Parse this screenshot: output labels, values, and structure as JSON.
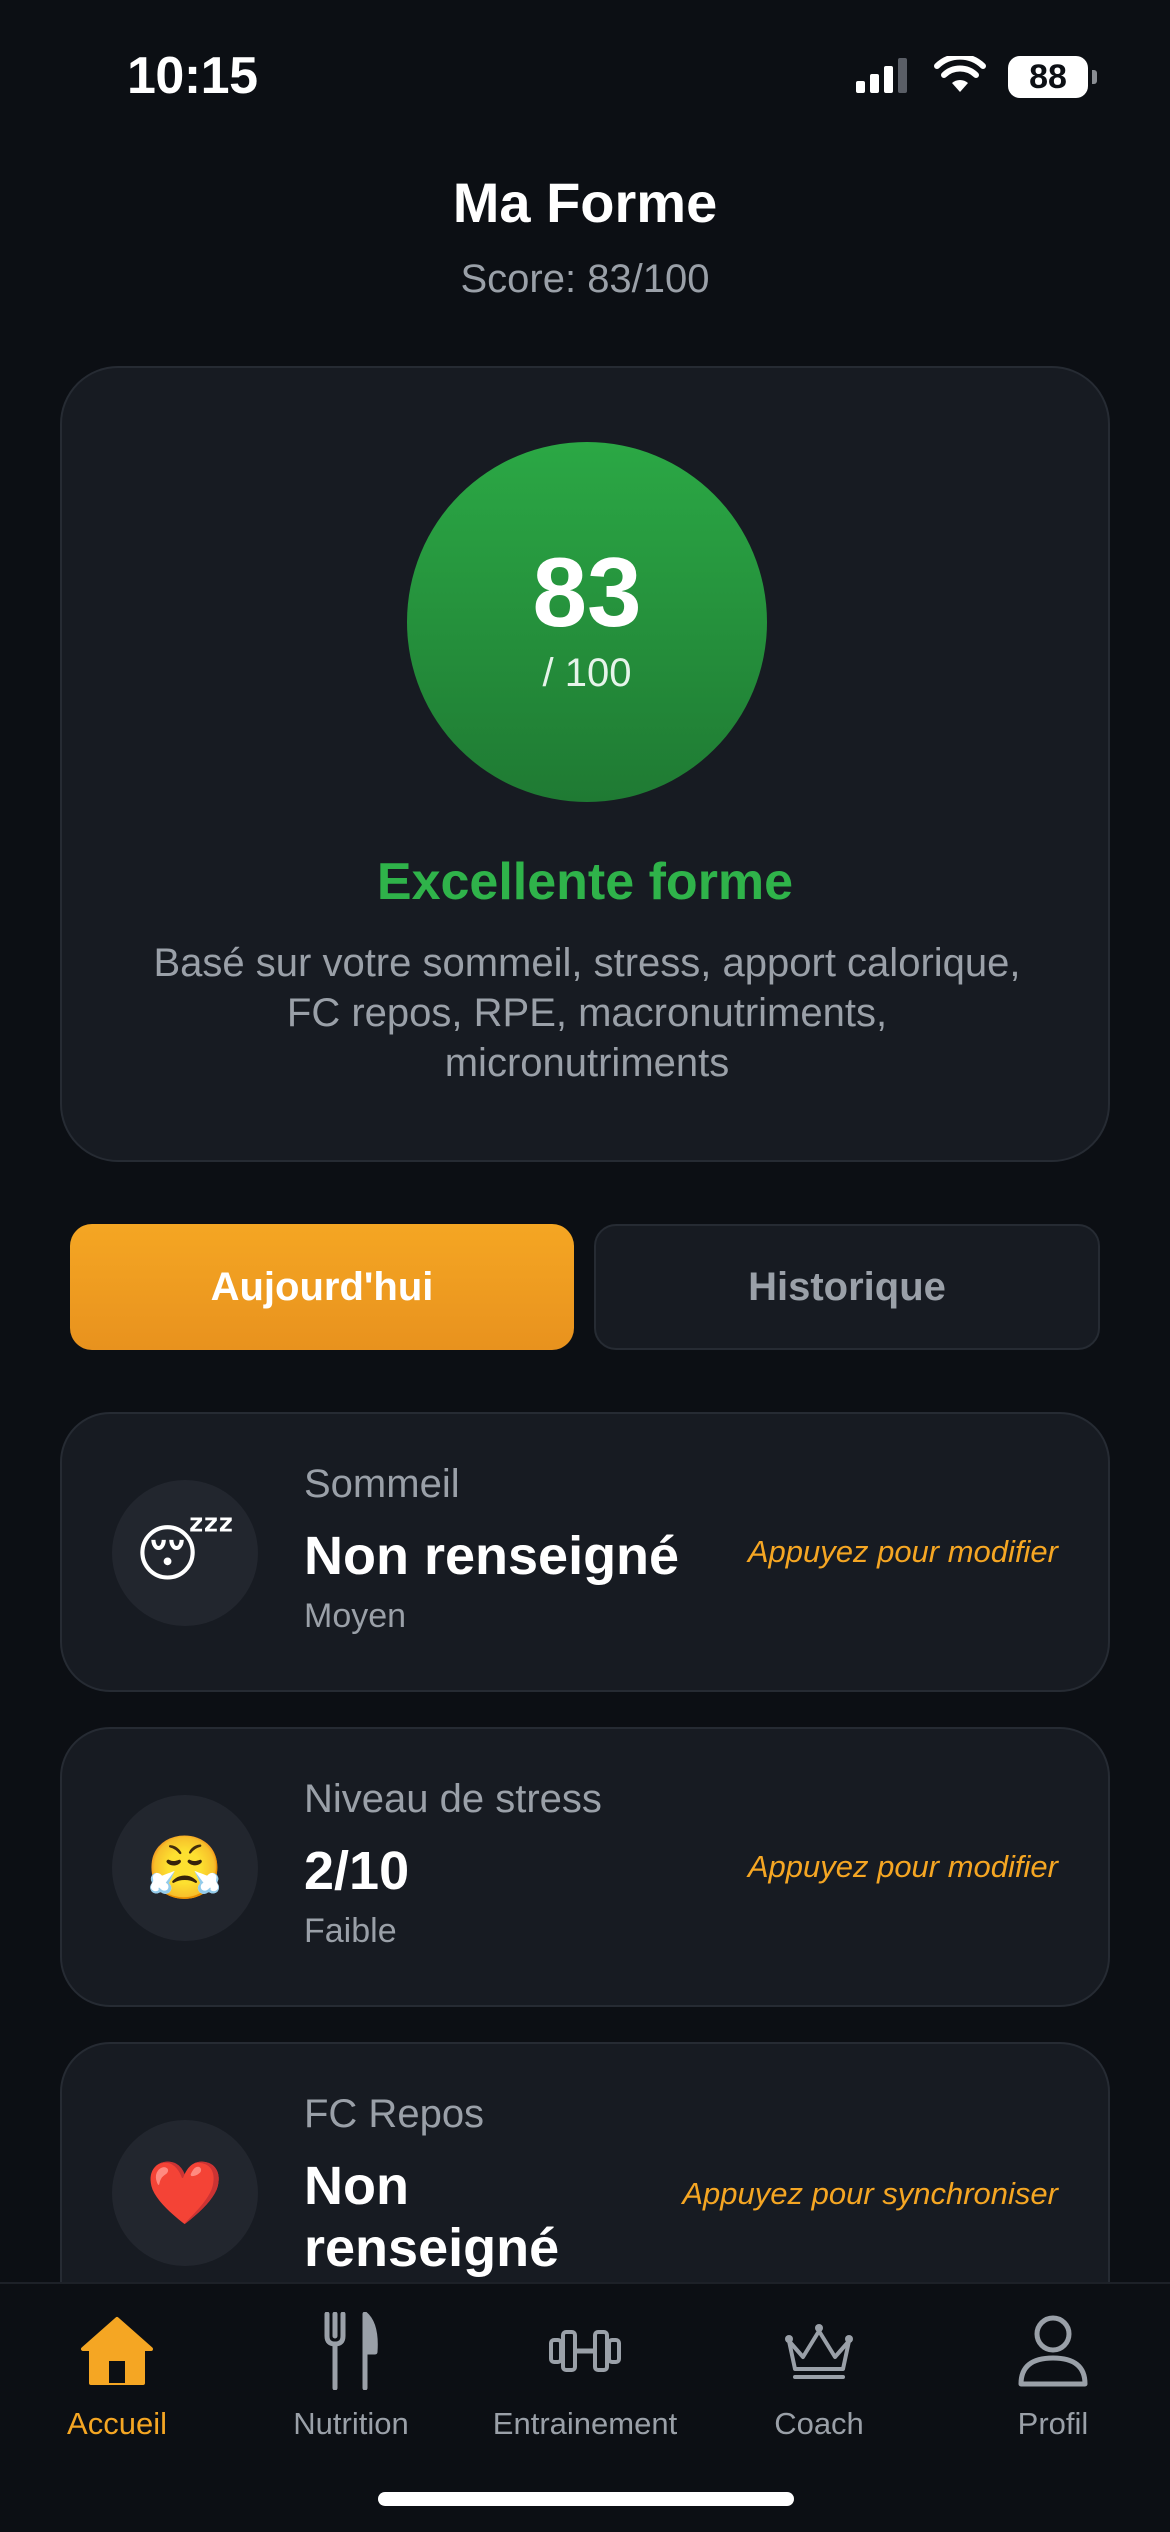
{
  "status_bar": {
    "time": "10:15",
    "battery": "88"
  },
  "header": {
    "title": "Ma Forme",
    "subtitle": "Score: 83/100"
  },
  "score_card": {
    "score": "83",
    "max": "/ 100",
    "label": "Excellente forme",
    "label_color": "#2fb34a",
    "description": "Basé sur votre sommeil, stress, apport calorique, FC repos, RPE, macronutriments, micronutriments"
  },
  "tabs": [
    {
      "label": "Aujourd'hui",
      "active": true
    },
    {
      "label": "Historique",
      "active": false
    }
  ],
  "metrics": [
    {
      "icon": "sleeping-face-emoji",
      "emoji": "😴",
      "label": "Sommeil",
      "value": "Non renseigné",
      "level": "Moyen",
      "action": "Appuyez pour modifier"
    },
    {
      "icon": "huffing-face-emoji",
      "emoji": "😤",
      "label": "Niveau de stress",
      "value": "2/10",
      "level": "Faible",
      "action": "Appuyez pour modifier"
    },
    {
      "icon": "red-heart-emoji",
      "emoji": "❤️",
      "label": "FC Repos",
      "value_line1": "Non",
      "value_line2": "renseigné",
      "action": "Appuyez pour synchroniser"
    }
  ],
  "nav": [
    {
      "icon": "home-icon",
      "label": "Accueil",
      "active": true
    },
    {
      "icon": "fork-knife-icon",
      "label": "Nutrition",
      "active": false
    },
    {
      "icon": "dumbbell-icon",
      "label": "Entrainement",
      "active": false
    },
    {
      "icon": "crown-icon",
      "label": "Coach",
      "active": false
    },
    {
      "icon": "profile-icon",
      "label": "Profil",
      "active": false
    }
  ],
  "colors": {
    "accent": "#f5a623",
    "background": "#0c0f14",
    "card": "#171b22",
    "success": "#2ba845"
  }
}
